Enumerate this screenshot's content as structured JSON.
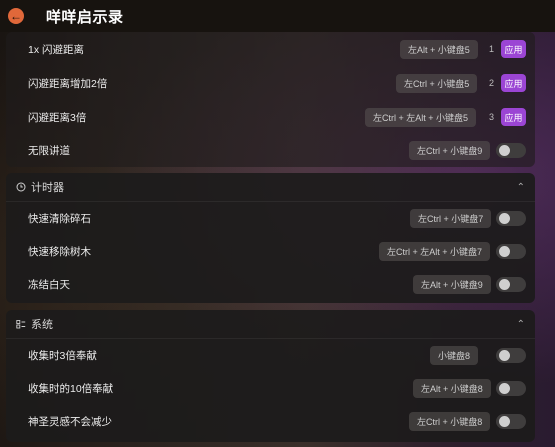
{
  "header": {
    "title": "咩咩启示录",
    "back_icon": "arrow-left-icon"
  },
  "teleport": {
    "rows": [
      {
        "label": "1x 闪避距离",
        "hotkey": "左Alt + 小键盘5",
        "number": "1",
        "action": "应用"
      },
      {
        "label": "闪避距离增加2倍",
        "hotkey": "左Ctrl + 小键盘5",
        "number": "2",
        "action": "应用"
      },
      {
        "label": "闪避距离3倍",
        "hotkey": "左Ctrl + 左Alt + 小键盘5",
        "number": "3",
        "action": "应用"
      },
      {
        "label": "无限讲道",
        "hotkey": "左Ctrl + 小键盘9"
      }
    ]
  },
  "timer": {
    "title": "计时器",
    "rows": [
      {
        "label": "快速清除碎石",
        "hotkey": "左Ctrl + 小键盘7"
      },
      {
        "label": "快速移除树木",
        "hotkey": "左Ctrl + 左Alt + 小键盘7"
      },
      {
        "label": "冻结白天",
        "hotkey": "左Alt + 小键盘9"
      }
    ]
  },
  "system": {
    "title": "系统",
    "rows": [
      {
        "label": "收集时3倍奉献",
        "hotkey": "小键盘8"
      },
      {
        "label": "收集时的10倍奉献",
        "hotkey": "左Alt + 小键盘8"
      },
      {
        "label": "神圣灵感不会减少",
        "hotkey": "左Ctrl + 小键盘8"
      }
    ]
  },
  "colors": {
    "accent": "#9b45d4",
    "back_button": "#e0683a"
  }
}
